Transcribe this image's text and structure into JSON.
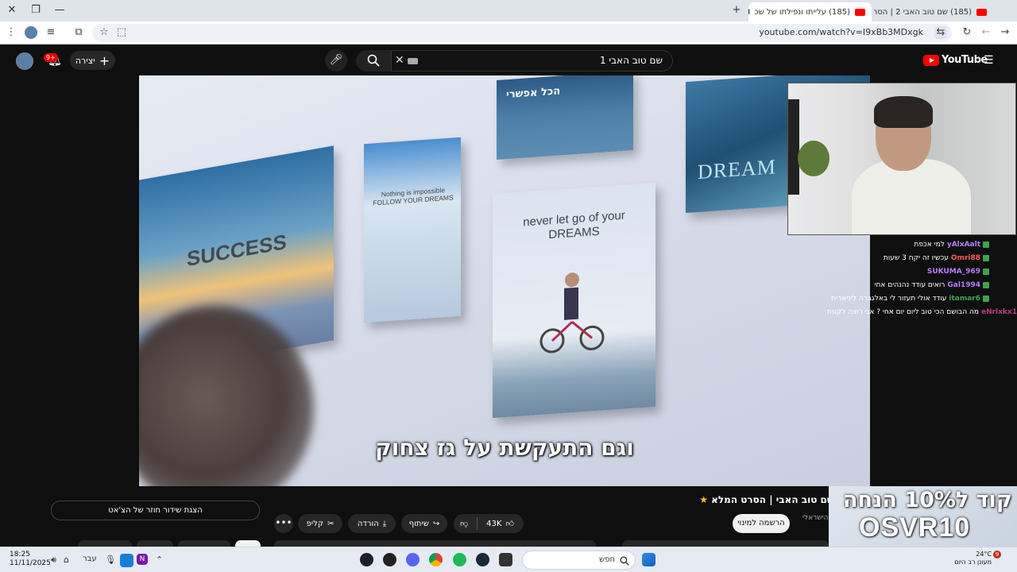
{
  "browser": {
    "tabs": [
      {
        "title": "(185) עלייתו ונפילתו של שכ"
      },
      {
        "title": "(185) שם טוב האבי 2 | הסרט הר"
      }
    ],
    "url": "youtube.com/watch?v=I9xBb3MDxgk"
  },
  "youtube": {
    "logo": "YouTube",
    "search_value": "שם טוב האבי 1",
    "create_label": "יצירה",
    "notif_count": "9+"
  },
  "video": {
    "subtitle": "וגם התעקשת על גז צחוק",
    "posters": {
      "success": "SUCCESS",
      "nothing": "Nothing is impossible FOLLOW YOUR DREAMS",
      "never": "never let go of your DREAMS",
      "top": "הכל אפשרי",
      "dream": "DREAM"
    }
  },
  "chat": [
    {
      "name": "yAlxAalt",
      "msg": "למי אכפת",
      "color": "#b77cff"
    },
    {
      "name": "Omri88",
      "msg": "עכשיו זה יקח 3 שעות",
      "color": "#ff5a5a"
    },
    {
      "name": "SUKUMA_969",
      "msg": "",
      "color": "#b77cff"
    },
    {
      "name": "Gal1994",
      "msg": "רואים עודד נהנהים אחי",
      "color": "#b77cff"
    },
    {
      "name": "itamar6",
      "msg": "עודד אולי תעזור לי באלגברה ליניארית",
      "color": "#3fa34d"
    },
    {
      "name": "eNrlxkx1",
      "msg": "מה הבושם הכי טוב ליום יום אחי ? אני רוצה לקנות",
      "color": "#c0397a"
    }
  ],
  "below": {
    "title": "שם טוב האבי | הסרט המלא",
    "subscribe": "הרשמה למינוי",
    "channel_meta": "השידור הישראלי",
    "replay_chat": "הצגת שידור חוזר של הצ'אט",
    "like_count": "43K",
    "share": "שיתוף",
    "download": "הורדה",
    "clip": "קליפ"
  },
  "promo": {
    "line1": "קוד ל10% הנחה",
    "line2": "OSVR10"
  },
  "taskbar": {
    "time": "18:25",
    "date": "11/11/2025",
    "lang": "עבר",
    "search_placeholder": "חפש",
    "temp": "24°C",
    "weather": "מעונן רב היום",
    "notif": "9"
  }
}
